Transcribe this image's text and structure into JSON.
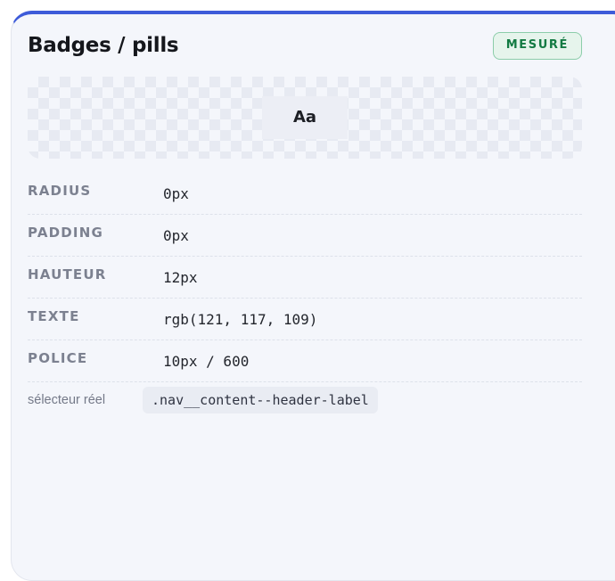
{
  "card": {
    "title": "Badges / pills",
    "status_badge": "MESURÉ",
    "preview_sample": "Aa",
    "accent_color": "#3d5bd9",
    "badge_color": "#137a43"
  },
  "properties": [
    {
      "label": "RADIUS",
      "value": "0px"
    },
    {
      "label": "PADDING",
      "value": "0px"
    },
    {
      "label": "HAUTEUR",
      "value": "12px"
    },
    {
      "label": "TEXTE",
      "value": "rgb(121, 117, 109)"
    },
    {
      "label": "POLICE",
      "value": "10px / 600"
    }
  ],
  "selector": {
    "label": "sélecteur réel",
    "value": ".nav__content--header-label"
  }
}
